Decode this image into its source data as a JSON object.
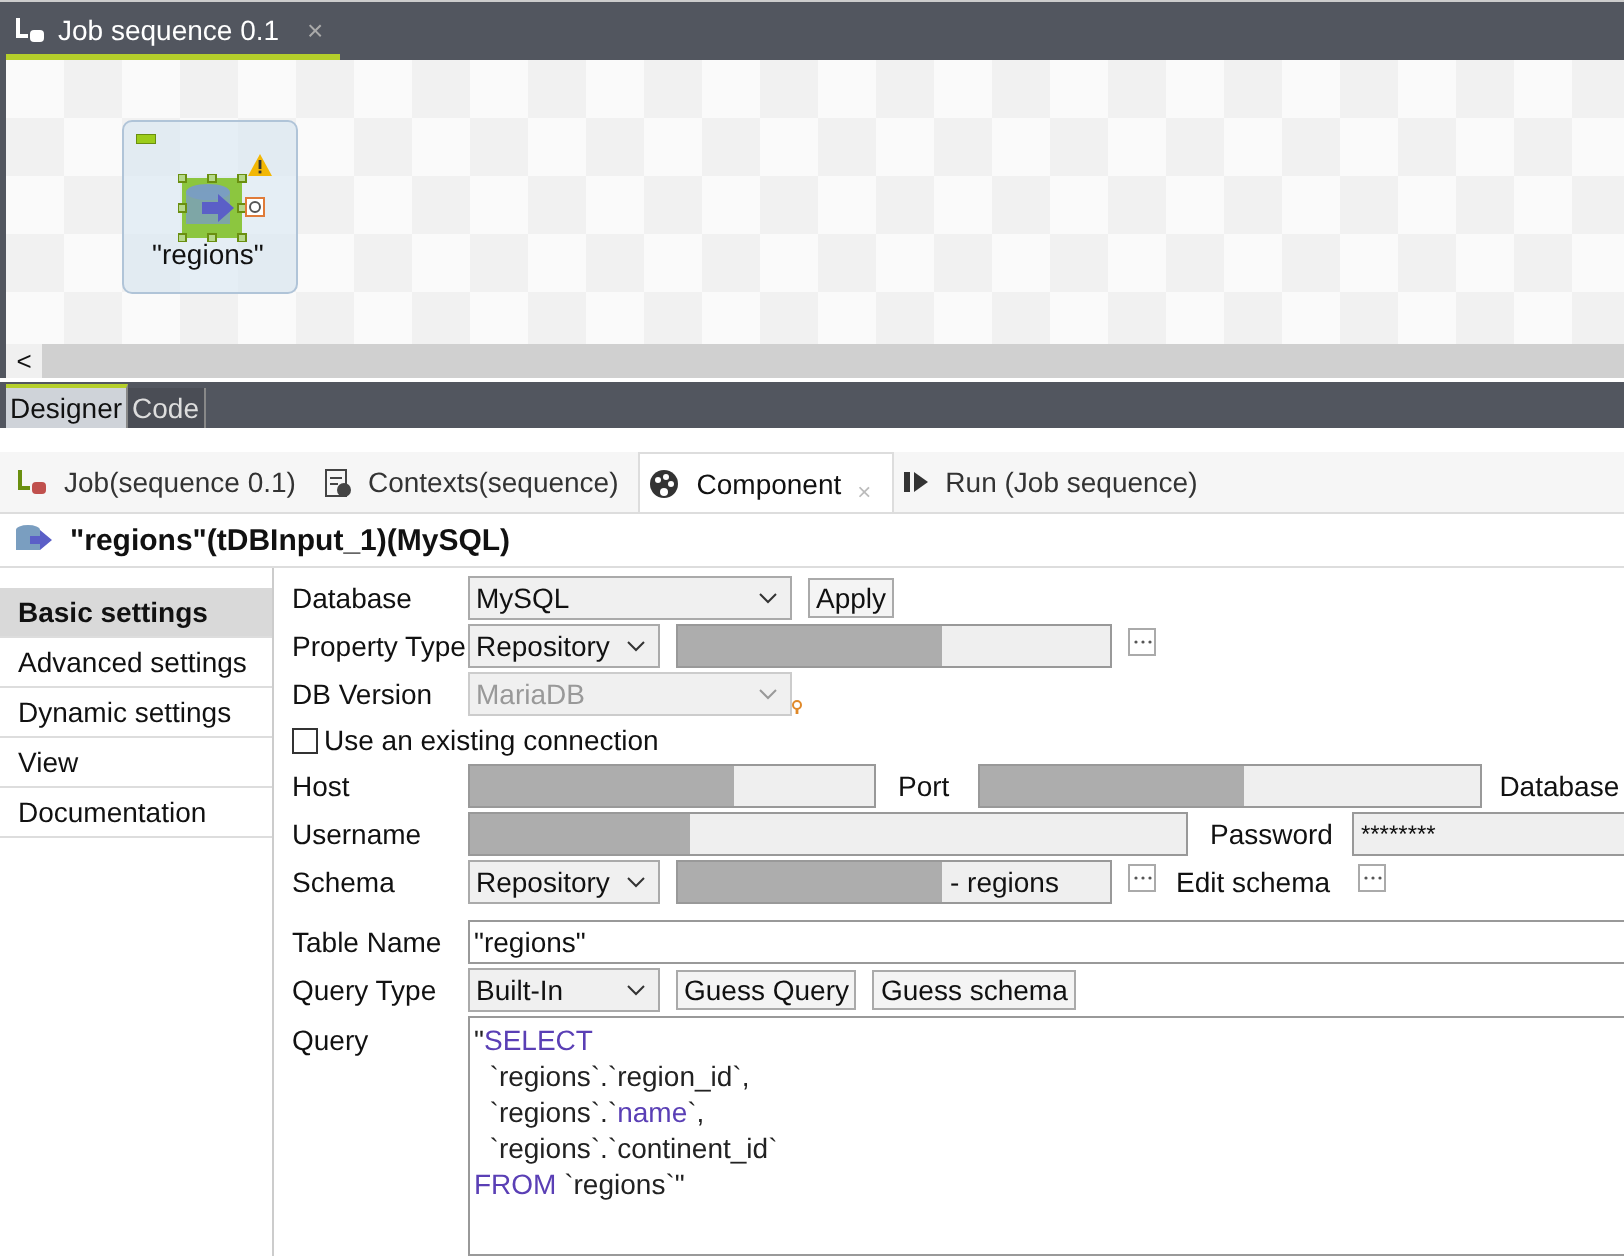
{
  "editor_tab": {
    "title": "Job sequence 0.1",
    "close": "×",
    "selected": true
  },
  "canvas": {
    "component": {
      "label": "\"regions\"",
      "warning": true
    }
  },
  "scroll_left": "<",
  "view_tabs": [
    {
      "label": "Designer",
      "selected": true
    },
    {
      "label": "Code",
      "selected": false
    }
  ],
  "panel_tabs": [
    {
      "label": "Job(sequence 0.1)",
      "selected": false
    },
    {
      "label": "Contexts(sequence)",
      "selected": false
    },
    {
      "label": "Component",
      "selected": true,
      "close": "×"
    },
    {
      "label": "Run (Job sequence)",
      "selected": false
    }
  ],
  "component_title": "\"regions\"(tDBInput_1)(MySQL)",
  "sidebar": {
    "items": [
      {
        "label": "Basic settings",
        "selected": true
      },
      {
        "label": "Advanced settings",
        "selected": false
      },
      {
        "label": "Dynamic settings",
        "selected": false
      },
      {
        "label": "View",
        "selected": false
      },
      {
        "label": "Documentation",
        "selected": false
      }
    ]
  },
  "form": {
    "database": {
      "label": "Database",
      "value": "MySQL",
      "button": "Apply"
    },
    "property_type": {
      "label": "Property Type",
      "value": "Repository",
      "redacted": true
    },
    "db_version": {
      "label": "DB Version",
      "value": "MariaDB",
      "disabled": true
    },
    "use_existing": {
      "label": "Use an existing connection",
      "checked": false
    },
    "host": {
      "label": "Host",
      "redacted": true
    },
    "port": {
      "label": "Port",
      "redacted": true
    },
    "database_name": {
      "label": "Database"
    },
    "username": {
      "label": "Username",
      "redacted": true
    },
    "password": {
      "label": "Password",
      "value": "********"
    },
    "schema": {
      "label": "Schema",
      "value": "Repository",
      "redacted": true,
      "suffix": "- regions",
      "edit_label": "Edit schema"
    },
    "table_name": {
      "label": "Table Name",
      "value": "\"regions\""
    },
    "query_type": {
      "label": "Query Type",
      "value": "Built-In",
      "buttons": [
        "Guess Query",
        "Guess schema"
      ]
    },
    "query": {
      "label": "Query",
      "lines": [
        [
          {
            "text": "\"",
            "kind": "plain"
          },
          {
            "text": "SELECT",
            "kind": "keyword"
          }
        ],
        [
          {
            "text": "  `regions`.`region_id`,",
            "kind": "plain"
          }
        ],
        [
          {
            "text": "  `regions`.`",
            "kind": "plain"
          },
          {
            "text": "name",
            "kind": "keyword"
          },
          {
            "text": "`,",
            "kind": "plain"
          }
        ],
        [
          {
            "text": "  `regions`.`continent_id`",
            "kind": "plain"
          }
        ],
        [
          {
            "text": "FROM",
            "kind": "keyword"
          },
          {
            "text": " `regions`\"",
            "kind": "plain"
          }
        ]
      ]
    }
  }
}
